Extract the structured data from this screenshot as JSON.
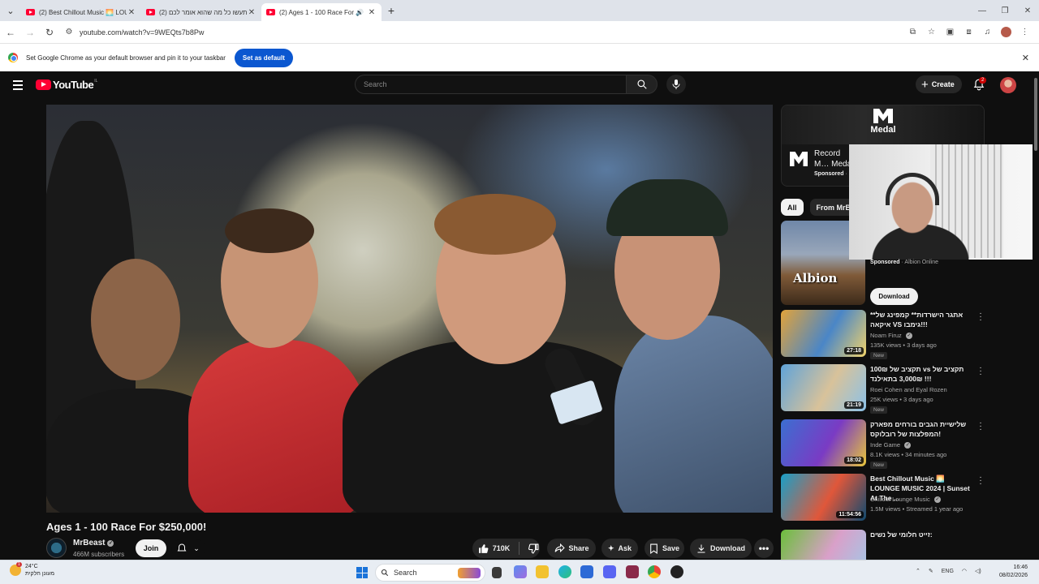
{
  "browser": {
    "tabs": [
      {
        "title": "(2) Best Chillout Music 🌅 LOUN",
        "active": false,
        "audio": false
      },
      {
        "title": "(2) תעשו כל מה שהוא אומר לכם",
        "active": false,
        "audio": false
      },
      {
        "title": "(2) Ages 1 - 100 Race For $",
        "active": true,
        "audio": true
      }
    ],
    "url": "youtube.com/watch?v=9WEQts7b8Pw",
    "banner_text": "Set Google Chrome as your default browser and pin it to your taskbar",
    "banner_button": "Set as default"
  },
  "youtube": {
    "logo_text": "YouTube",
    "logo_superscript": "IL",
    "search_placeholder": "Search",
    "create_label": "Create",
    "notification_count": "2"
  },
  "video": {
    "title": "Ages 1 - 100 Race For $250,000!",
    "channel": "MrBeast",
    "subscribers": "466M subscribers",
    "join_label": "Join",
    "likes": "710K",
    "share_label": "Share",
    "ask_label": "Ask",
    "save_label": "Save",
    "download_label": "Download"
  },
  "sidebar": {
    "ad": {
      "brand": "Medal",
      "title": "Record M… Medal",
      "sponsored": "Sponsored",
      "dot": "·"
    },
    "chips": [
      "All",
      "From MrBea"
    ],
    "albion_ad": {
      "logo": "Albion",
      "sponsored": "Sponsored",
      "advertiser": "· Albion Online",
      "button": "Download"
    },
    "recommendations": [
      {
        "title": "**אתגר הישרדות** קמפינג של איקאה VS גימבו!!!",
        "channel": "Noam Firuz",
        "verified": true,
        "meta": "135K views • 3 days ago",
        "badge": "New",
        "duration": "27:18",
        "colors": [
          "#e2a33a",
          "#4a86c7",
          "#f0d26a"
        ]
      },
      {
        "title": "תקציב של 100₪ vs תקציב של 3,000₪ בתאילנד !!!",
        "channel": "Roei Cohen and Eyal Rozen",
        "verified": false,
        "meta": "25K views • 3 days ago",
        "badge": "New",
        "duration": "21:19",
        "colors": [
          "#5fa3d9",
          "#d8c29a",
          "#8bc1e8"
        ]
      },
      {
        "title": "שלישיית הגבים בורחים מפארק המפלצות של רובלוקס!",
        "channel": "Inde Game",
        "verified": true,
        "meta": "8.1K views • 34 minutes ago",
        "badge": "New",
        "duration": "18:02",
        "colors": [
          "#3b6fd1",
          "#7a3bc4",
          "#e8c63a"
        ]
      },
      {
        "title": "Best Chillout Music 🌅 LOUNGE MUSIC 2024 | Sunset At The ...",
        "channel": "Chillout Lounge Music",
        "verified": true,
        "meta": "1.5M views • Streamed 1 year ago",
        "badge": "",
        "duration": "11:54:56",
        "colors": [
          "#19a0c8",
          "#e0573a",
          "#0f4a70"
        ]
      },
      {
        "title": "זייט חלומי של נשים:",
        "channel": "",
        "verified": false,
        "meta": "",
        "badge": "",
        "duration": "",
        "colors": [
          "#6bbf3b",
          "#d9a0c9",
          "#a0c9e8"
        ]
      }
    ]
  },
  "taskbar": {
    "weather_temp": "24°C",
    "weather_desc": "מעונן חלקית",
    "weather_alert": "1",
    "search_label": "Search",
    "lang": "ENG",
    "time": "16:46",
    "date": "08/02/2026"
  }
}
